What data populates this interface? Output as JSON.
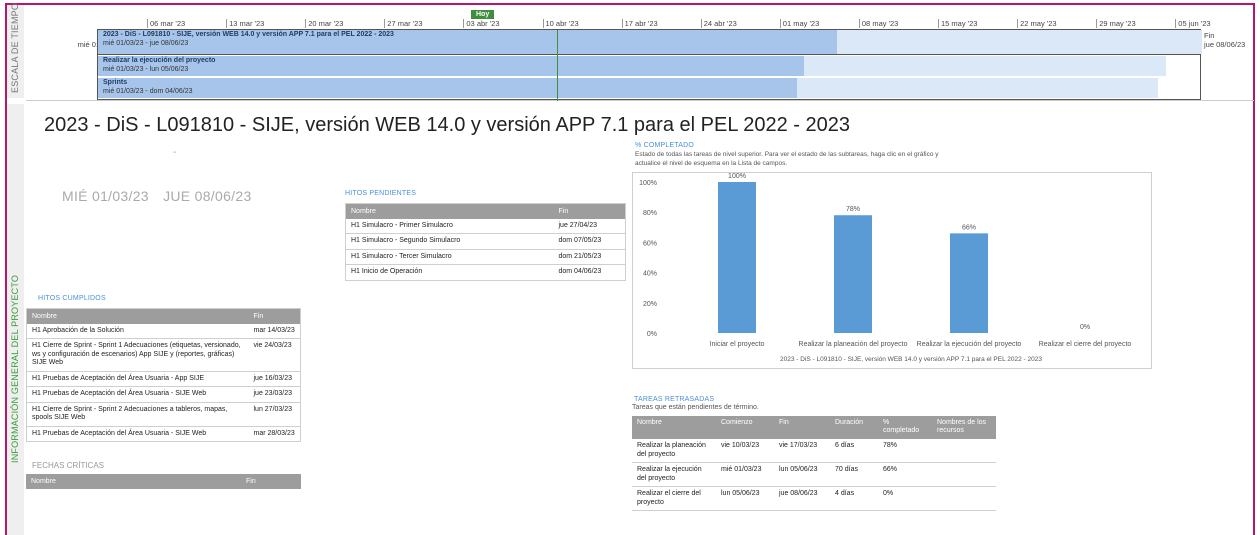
{
  "side_labels": {
    "timeline": "ESCALA DE TIEMPO",
    "overview": "INFORMACIÓN GENERAL DEL PROYECTO"
  },
  "timeline": {
    "today_label": "Hoy",
    "start_label": "Inicio",
    "start_date": "mié 01/03/23",
    "end_label": "Fin",
    "end_date": "jue 08/06/23",
    "ticks": [
      "06 mar '23",
      "13 mar '23",
      "20 mar '23",
      "27 mar '23",
      "03 abr '23",
      "10 abr '23",
      "17 abr '23",
      "24 abr '23",
      "01 may '23",
      "08 may '23",
      "15 may '23",
      "22 may '23",
      "29 may '23",
      "05 jun '23"
    ],
    "bars": [
      {
        "name": "2023 - DiS - L091810 - SIJE, versión WEB 14.0 y versión APP 7.1 para el PEL 2022 - 2023",
        "dates": "mié 01/03/23 - jue 08/06/23"
      },
      {
        "name": "Realizar la ejecución del proyecto",
        "dates": "mié 01/03/23 - lun 05/06/23"
      },
      {
        "name": "Sprints",
        "dates": "mié 01/03/23 - dom 04/06/23"
      }
    ]
  },
  "project": {
    "title": "2023 - DiS - L091810 - SIJE, versión WEB 14.0 y versión APP 7.1 para el PEL 2022 - 2023",
    "dash": "-",
    "start": "MIÉ 01/03/23",
    "end": "JUE 08/06/23"
  },
  "hitos_pendientes": {
    "title": "HITOS PENDIENTES",
    "headers": [
      "Nombre",
      "Fin"
    ],
    "rows": [
      [
        "H1 Simulacro - Primer Simulacro",
        "jue 27/04/23"
      ],
      [
        "H1 Simulacro - Segundo Simulacro",
        "dom 07/05/23"
      ],
      [
        "H1 Simulacro - Tercer Simulacro",
        "dom 21/05/23"
      ],
      [
        "H1 Inicio de Operación",
        "dom 04/06/23"
      ]
    ]
  },
  "hitos_cumplidos": {
    "title": "HITOS CUMPLIDOS",
    "headers": [
      "Nombre",
      "Fin"
    ],
    "rows": [
      [
        "H1 Aprobación de la Solución",
        "mar 14/03/23"
      ],
      [
        "H1 Cierre de Sprint - Sprint 1 Adecuaciones (etiquetas, versionado, ws y configuración de escenarios) App SIJE y (reportes, gráficas) SIJE Web",
        "vie 24/03/23"
      ],
      [
        "H1 Pruebas de Aceptación del Área Usuaria - App SIJE",
        "jue 16/03/23"
      ],
      [
        "H1 Pruebas de Aceptación del Área Usuaria - SIJE Web",
        "jue 23/03/23"
      ],
      [
        "H1 Cierre de Sprint - Sprint 2 Adecuaciones a tableros, mapas, spools SIJE Web",
        "lun 27/03/23"
      ],
      [
        "H1 Pruebas de Aceptación del Área Usuaria - SIJE Web",
        "mar 28/03/23"
      ]
    ]
  },
  "fechas_criticas": {
    "title": "FECHAS CRÍTICAS",
    "headers": [
      "Nombre",
      "Fin"
    ]
  },
  "completado": {
    "title": "% COMPLETADO",
    "description": "Estado de todas las tareas de nivel superior. Para ver el estado de las subtareas, haga clic en el gráfico y actualice el nivel de esquema en la Lista de campos."
  },
  "chart_data": {
    "type": "bar",
    "categories": [
      "Iniciar el proyecto",
      "Realizar la planeación del proyecto",
      "Realizar la ejecución del proyecto",
      "Realizar el cierre del proyecto"
    ],
    "values": [
      100,
      78,
      66,
      0
    ],
    "data_labels": [
      "100%",
      "78%",
      "66%",
      "0%"
    ],
    "xlabel": "2023 - DiS - L091810 - SIJE, versión WEB 14.0 y versión APP 7.1 para el PEL 2022 - 2023",
    "ylim": [
      0,
      100
    ],
    "y_ticks": [
      "0%",
      "20%",
      "40%",
      "60%",
      "80%",
      "100%"
    ],
    "y_tick_values": [
      0,
      20,
      40,
      60,
      80,
      100
    ],
    "bar_color": "#5b9bd5",
    "grid": false
  },
  "tareas_retrasadas": {
    "title": "TAREAS RETRASADAS",
    "description": "Tareas que están pendientes de término.",
    "headers": [
      "Nombre",
      "Comienzo",
      "Fin",
      "Duración",
      "% completado",
      "Nombres de los recursos"
    ],
    "rows": [
      [
        "Realizar la planeación del proyecto",
        "vie 10/03/23",
        "vie 17/03/23",
        "6 días",
        "78%",
        ""
      ],
      [
        "Realizar la ejecución del proyecto",
        "mié 01/03/23",
        "lun 05/06/23",
        "70 días",
        "66%",
        ""
      ],
      [
        "Realizar el cierre del proyecto",
        "lun 05/06/23",
        "jue 08/06/23",
        "4 días",
        "0%",
        ""
      ]
    ]
  },
  "colors": {
    "frame": "#b5176d",
    "accent": "#4a90d9",
    "today": "#3e8e3e",
    "timeline_done": "#a7c5ea",
    "timeline_rest": "#dbe8f7",
    "table_header": "#9d9d9d"
  }
}
